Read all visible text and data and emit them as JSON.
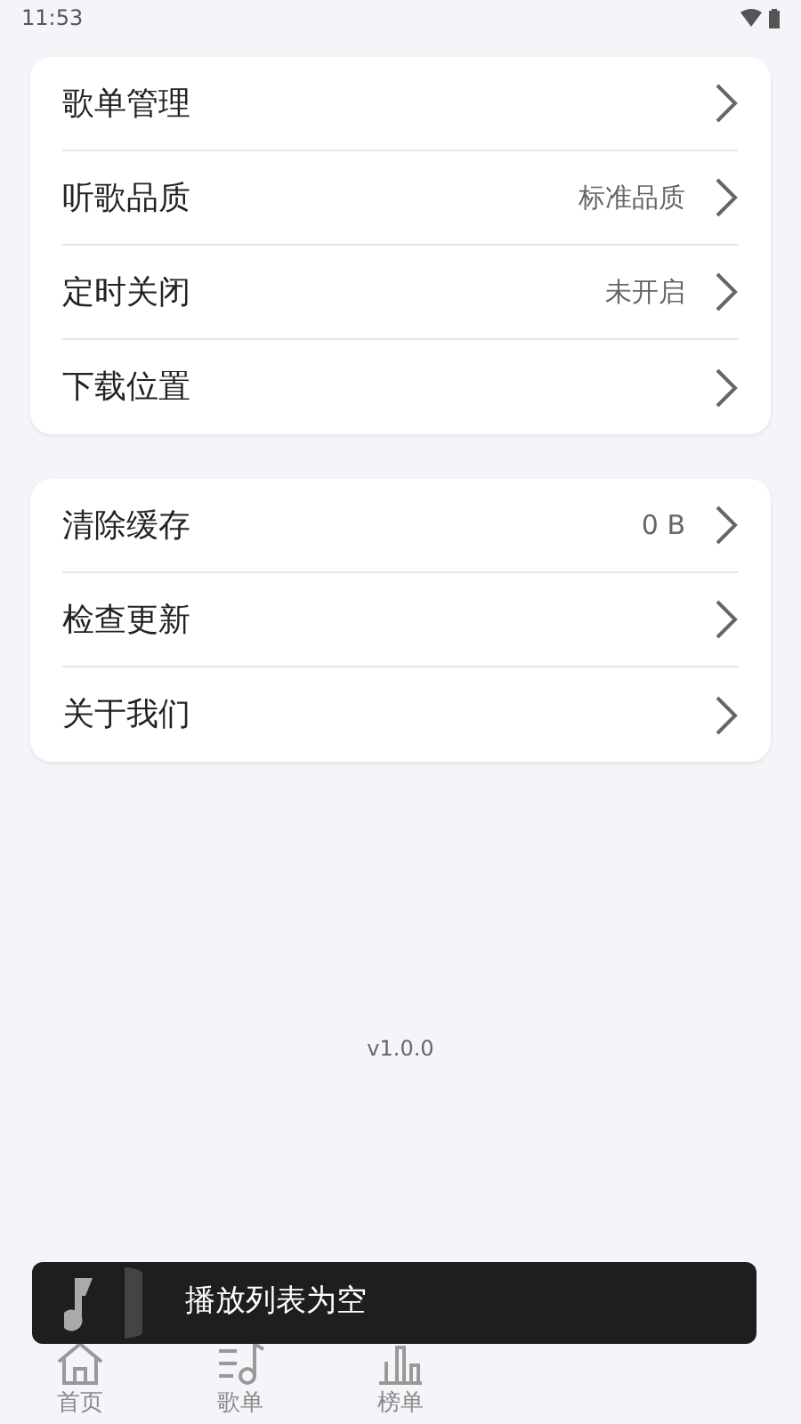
{
  "status_bar": {
    "time": "11:53"
  },
  "groups": [
    {
      "items": [
        {
          "label": "歌单管理"
        },
        {
          "label": "听歌品质",
          "value": "标准品质"
        },
        {
          "label": "定时关闭",
          "value": "未开启"
        },
        {
          "label": "下载位置"
        }
      ]
    },
    {
      "items": [
        {
          "label": "清除缓存",
          "value": "0 B"
        },
        {
          "label": "检查更新"
        },
        {
          "label": "关于我们"
        }
      ]
    }
  ],
  "version": "v1.0.0",
  "toast": {
    "text": "播放列表为空"
  },
  "bottom_nav": [
    {
      "label": "首页",
      "kind": "home"
    },
    {
      "label": "歌单",
      "kind": "playlist"
    },
    {
      "label": "榜单",
      "kind": "chart"
    }
  ]
}
